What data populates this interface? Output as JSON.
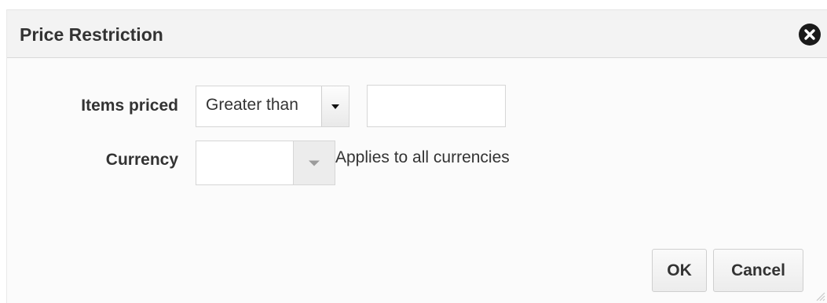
{
  "dialog": {
    "title": "Price Restriction",
    "close_icon": "close-icon"
  },
  "form": {
    "items_priced": {
      "label": "Items priced",
      "operator_value": "Greater than",
      "amount_value": ""
    },
    "currency": {
      "label": "Currency",
      "value": "",
      "hint": "Applies to all currencies"
    }
  },
  "buttons": {
    "ok_label": "OK",
    "cancel_label": "Cancel"
  },
  "colors": {
    "header_bg": "#f3f3f3",
    "body_bg": "#fbfbfb",
    "close_bg": "#1a1a1a"
  }
}
